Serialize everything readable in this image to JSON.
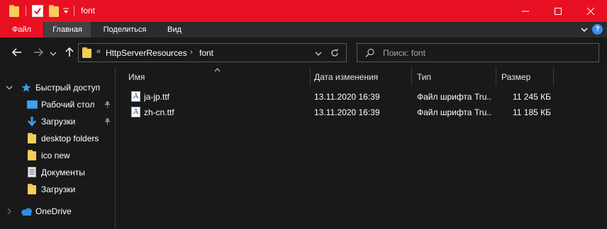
{
  "titlebar": {
    "title": "font",
    "icons": [
      "folder-icon",
      "properties-check-icon",
      "new-folder-icon",
      "quick-access-dropdown-icon"
    ],
    "minimize_icon": "minimize-icon",
    "maximize_icon": "maximize-icon",
    "close_icon": "close-icon",
    "accent_color": "#e81123"
  },
  "ribbon": {
    "tabs": [
      {
        "label": "Файл"
      },
      {
        "label": "Главная"
      },
      {
        "label": "Поделиться"
      },
      {
        "label": "Вид"
      }
    ],
    "expand_icon": "chevron-down-icon",
    "help_label": "?"
  },
  "navigation": {
    "back_icon": "arrow-left-icon",
    "forward_icon": "arrow-right-icon",
    "recent_icon": "chevron-down-icon",
    "up_icon": "arrow-up-icon",
    "breadcrumb": [
      "HttpServerResources",
      "font"
    ],
    "overflow_label": "«",
    "refresh_icon": "refresh-icon",
    "search_placeholder": "Поиск: font"
  },
  "sidebar": {
    "quick_access_label": "Быстрый доступ",
    "items": [
      {
        "label": "Рабочий стол",
        "icon": "desktop-icon",
        "pinned": true
      },
      {
        "label": "Загрузки",
        "icon": "download-icon",
        "pinned": true
      },
      {
        "label": "desktop folders",
        "icon": "folder-icon",
        "pinned": false
      },
      {
        "label": "ico new",
        "icon": "folder-icon",
        "pinned": false
      },
      {
        "label": "Документы",
        "icon": "documents-icon",
        "pinned": false
      },
      {
        "label": "Загрузки",
        "icon": "folder-icon",
        "pinned": false
      }
    ],
    "onedrive_label": "OneDrive"
  },
  "file_list": {
    "columns": [
      "Имя",
      "Дата изменения",
      "Тип",
      "Размер"
    ],
    "rows": [
      {
        "name": "ja-jp.ttf",
        "date": "13.11.2020 16:39",
        "type": "Файл шрифта Tru...",
        "size": "11 245 КБ"
      },
      {
        "name": "zh-cn.ttf",
        "date": "13.11.2020 16:39",
        "type": "Файл шрифта Tru...",
        "size": "11 185 КБ"
      }
    ]
  }
}
